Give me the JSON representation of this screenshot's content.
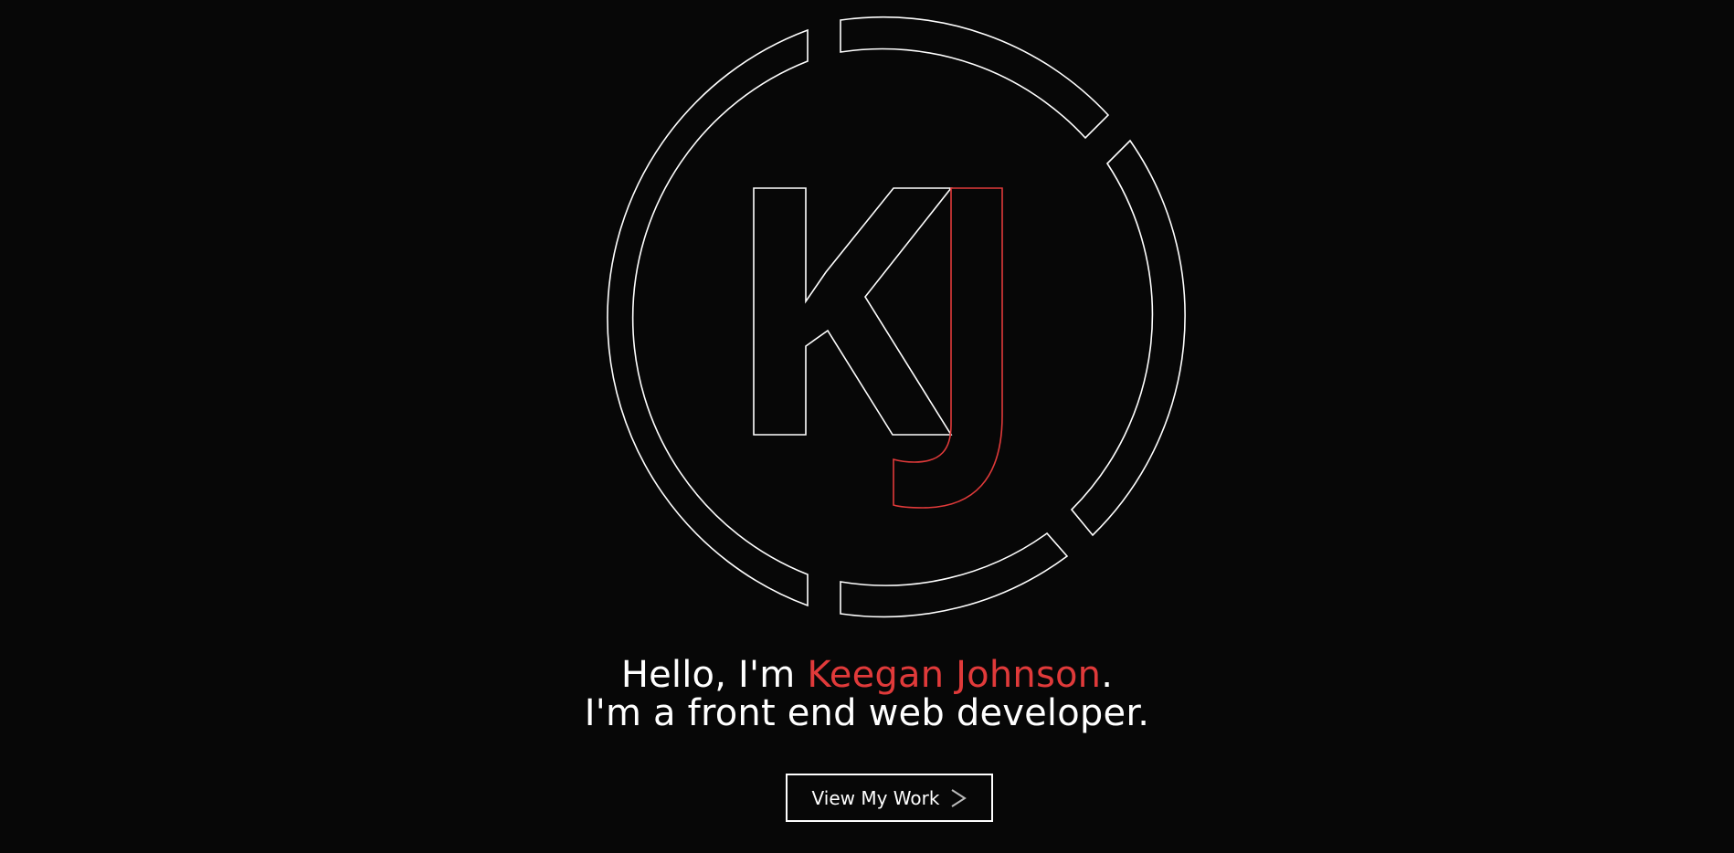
{
  "hero": {
    "greeting_prefix": "Hello, I'm ",
    "name": "Keegan Johnson",
    "greeting_suffix": ".",
    "tagline": "I'm a front end web developer."
  },
  "cta": {
    "label": "View My Work",
    "icon": "chevron-right-icon"
  },
  "logo": {
    "initials": "KJ",
    "icon": "kj-monogram-logo"
  },
  "colors": {
    "background": "#070707",
    "foreground": "#ffffff",
    "accent": "#e03a3a"
  }
}
